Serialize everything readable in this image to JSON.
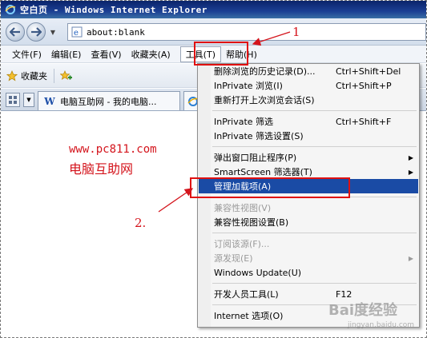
{
  "window": {
    "title": "空白页 - Windows Internet Explorer"
  },
  "address_bar": {
    "value": "about:blank"
  },
  "menu_bar": {
    "items": [
      {
        "label": "文件(F)"
      },
      {
        "label": "编辑(E)"
      },
      {
        "label": "查看(V)"
      },
      {
        "label": "收藏夹(A)"
      },
      {
        "label": "工具(T)"
      },
      {
        "label": "帮助(H)"
      }
    ]
  },
  "favorites_bar": {
    "label": "收藏夹"
  },
  "tabs": [
    {
      "label": "电脑互助网 - 我的电脑..."
    }
  ],
  "content": {
    "site_url": "www.pc811.com",
    "site_name": "电脑互助网"
  },
  "annotations": {
    "one": "1",
    "two": "2."
  },
  "tools_menu": {
    "items": [
      {
        "label": "删除浏览的历史记录(D)...",
        "shortcut": "Ctrl+Shift+Del"
      },
      {
        "label": "InPrivate 浏览(I)",
        "shortcut": "Ctrl+Shift+P"
      },
      {
        "label": "重新打开上次浏览会话(S)",
        "shortcut": ""
      },
      {
        "label": "InPrivate 筛选",
        "shortcut": "Ctrl+Shift+F"
      },
      {
        "label": "InPrivate 筛选设置(S)",
        "shortcut": ""
      },
      {
        "label": "弹出窗口阻止程序(P)",
        "shortcut": ""
      },
      {
        "label": "SmartScreen 筛选器(T)",
        "shortcut": ""
      },
      {
        "label": "管理加载项(A)",
        "shortcut": ""
      },
      {
        "label": "兼容性视图(V)",
        "shortcut": ""
      },
      {
        "label": "兼容性视图设置(B)",
        "shortcut": ""
      },
      {
        "label": "订阅该源(F)...",
        "shortcut": ""
      },
      {
        "label": "源发现(E)",
        "shortcut": ""
      },
      {
        "label": "Windows Update(U)",
        "shortcut": ""
      },
      {
        "label": "开发人员工具(L)",
        "shortcut": "F12"
      },
      {
        "label": "Internet 选项(O)",
        "shortcut": ""
      }
    ]
  },
  "watermark": {
    "text": "Bai度经验",
    "sub": "jingyan.baidu.com"
  },
  "colors": {
    "highlight": "#1a4ba5",
    "annotation_red": "#d4141c"
  }
}
